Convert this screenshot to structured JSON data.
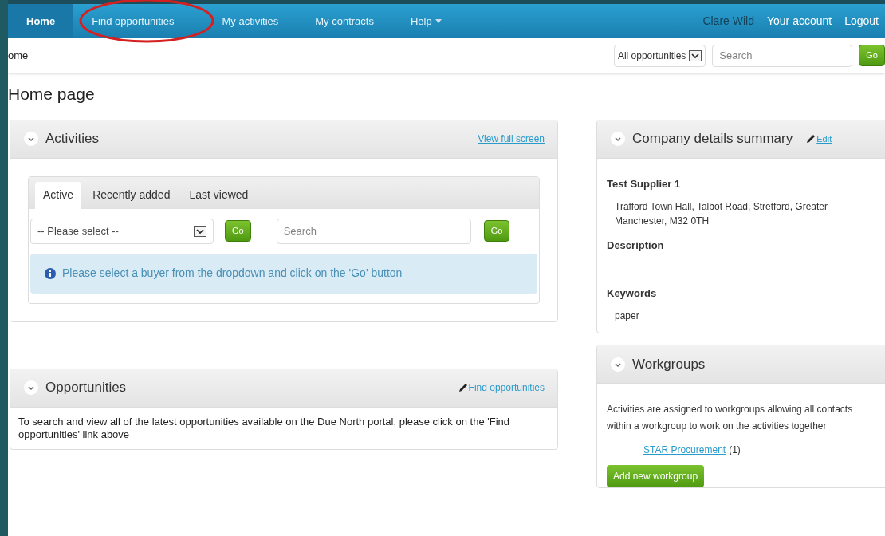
{
  "nav": {
    "items": [
      {
        "label": "Home",
        "selected": true
      },
      {
        "label": "Find opportunities",
        "selected": false,
        "circled": true
      },
      {
        "label": "My activities",
        "selected": false
      },
      {
        "label": "My contracts",
        "selected": false
      },
      {
        "label": "Help",
        "selected": false,
        "menu": true
      }
    ],
    "user": "Clare Wild",
    "links": [
      "Your account",
      "Logout"
    ]
  },
  "breadcrumb": "ome",
  "top_search": {
    "scope": "All opportunities",
    "placeholder": "Search",
    "button": "Go"
  },
  "page_title": "Home page",
  "activities": {
    "title": "Activities",
    "link": "View full screen",
    "tabs": [
      {
        "label": "Active",
        "selected": true
      },
      {
        "label": "Recently added",
        "selected": false
      },
      {
        "label": "Last viewed",
        "selected": false
      }
    ],
    "select": "-- Please select --",
    "go1": "Go",
    "search_placeholder": "Search",
    "go2": "Go",
    "info": "Please select a buyer from the dropdown and click on the 'Go' button"
  },
  "opportunities": {
    "title": "Opportunities",
    "link": "Find opportunities",
    "text": "To search and view all of the latest opportunities available on the Due North portal, please click on the 'Find opportunities' link above"
  },
  "company": {
    "title": "Company details summary",
    "edit": "Edit",
    "name": "Test Supplier 1",
    "address": "Trafford Town Hall, Talbot Road, Stretford, Greater Manchester, M32 0TH",
    "description_label": "Description",
    "keywords_label": "Keywords",
    "keywords": "paper"
  },
  "workgroups": {
    "title": "Workgroups",
    "text": "Activities are assigned to workgroups allowing all contacts within a workgroup to work on the activities together",
    "items": [
      {
        "name": "STAR Procurement",
        "count": "(1)"
      }
    ],
    "button": "Add new workgroup"
  }
}
